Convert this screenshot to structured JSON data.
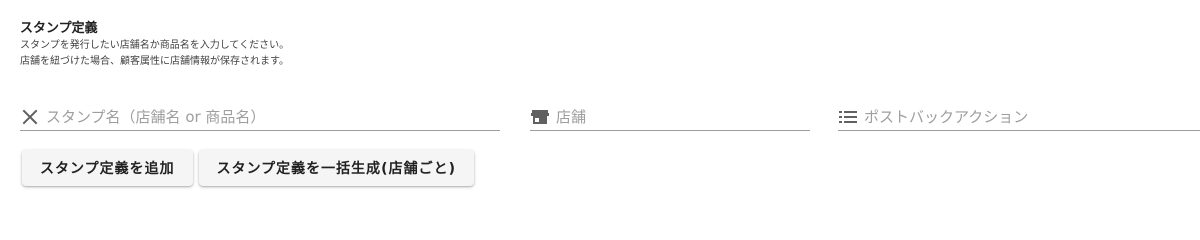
{
  "section": {
    "title": "スタンプ定義",
    "description_line1": "スタンプを発行したい店舗名か商品名を入力してください。",
    "description_line2": "店舗を紐づけた場合、顧客属性に店舗情報が保存されます。"
  },
  "fields": {
    "stamp_name": {
      "placeholder": "スタンプ名（店舗名 or 商品名）",
      "value": "",
      "icon": "close-icon"
    },
    "store": {
      "placeholder": "店舗",
      "value": "",
      "icon": "store-icon"
    },
    "postback": {
      "placeholder": "ポストバックアクション",
      "value": "",
      "icon": "list-icon"
    }
  },
  "buttons": {
    "add_label": "スタンプ定義を追加",
    "bulk_label": "スタンプ定義を一括生成(店舗ごと)"
  }
}
